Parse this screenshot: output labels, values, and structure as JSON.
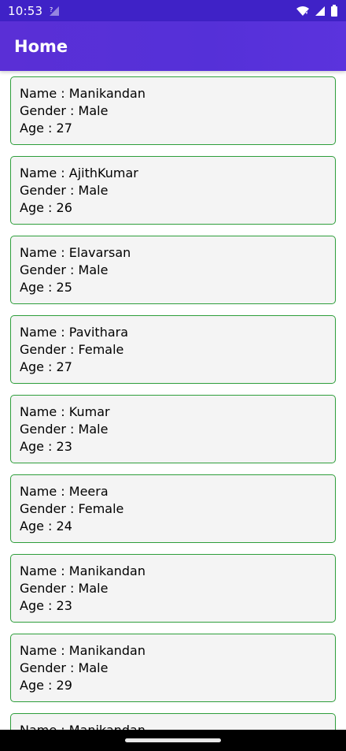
{
  "status_bar": {
    "time": "10:53",
    "icons": [
      "sim-no-signal-icon",
      "wifi-icon",
      "cell-signal-icon",
      "battery-icon"
    ]
  },
  "app_bar": {
    "title": "Home"
  },
  "colors": {
    "status_bar": "#3f22c7",
    "app_bar": "#5530d8",
    "card_border": "#2e9e3b",
    "card_background": "#f4f4f4"
  },
  "people": [
    {
      "name": "Name : Manikandan",
      "gender": "Gender : Male",
      "age": "Age : 27"
    },
    {
      "name": "Name : AjithKumar",
      "gender": "Gender : Male",
      "age": "Age : 26"
    },
    {
      "name": "Name : Elavarsan",
      "gender": "Gender : Male",
      "age": "Age : 25"
    },
    {
      "name": "Name : Pavithara",
      "gender": "Gender : Female",
      "age": "Age : 27"
    },
    {
      "name": "Name : Kumar",
      "gender": "Gender : Male",
      "age": "Age : 23"
    },
    {
      "name": "Name : Meera",
      "gender": "Gender : Female",
      "age": "Age : 24"
    },
    {
      "name": "Name : Manikandan",
      "gender": "Gender : Male",
      "age": "Age : 23"
    },
    {
      "name": "Name : Manikandan",
      "gender": "Gender : Male",
      "age": "Age : 29"
    },
    {
      "name": "Name : Manikandan"
    }
  ]
}
